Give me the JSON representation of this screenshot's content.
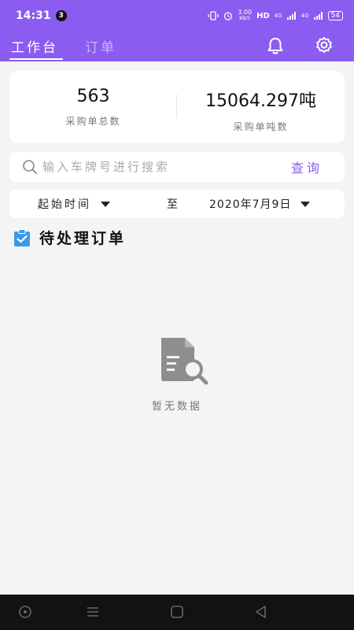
{
  "status_bar": {
    "time": "14:31",
    "notification_count": "3",
    "network_speed_value": "3.00",
    "network_speed_unit": "KB/S",
    "hd_label": "HD",
    "signal_1": "4G",
    "signal_2": "4G",
    "battery": "54"
  },
  "header": {
    "tabs": [
      {
        "label": "工作台",
        "active": true
      },
      {
        "label": "订单",
        "active": false
      }
    ],
    "bell_icon": "bell-icon",
    "gear_icon": "gear-icon",
    "color": "#8a5cf0"
  },
  "stats": {
    "total_orders_value": "563",
    "total_orders_label": "采购单总数",
    "total_tonnage_value": "15064.297吨",
    "total_tonnage_label": "采购单吨数"
  },
  "search": {
    "placeholder": "输入车牌号进行搜索",
    "value": "",
    "button_label": "查询"
  },
  "date_filter": {
    "start_label": "起始时间",
    "to_label": "至",
    "end_value": "2020年7月9日"
  },
  "section": {
    "title": "待处理订单",
    "icon": "clipboard-check-icon"
  },
  "empty_state": {
    "icon": "document-search-icon",
    "text": "暂无数据"
  },
  "nav_bar": {
    "buttons": [
      "assistant-icon",
      "menu-icon",
      "home-icon",
      "back-icon"
    ]
  }
}
